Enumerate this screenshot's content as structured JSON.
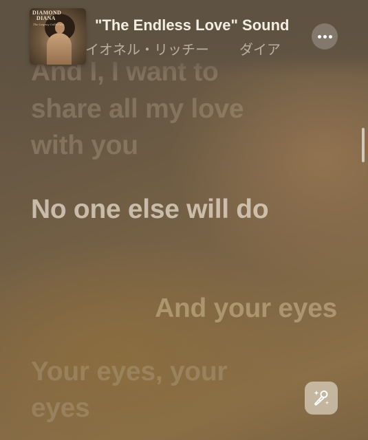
{
  "now_playing": {
    "title": "\"The Endless Love\" Sound",
    "artists": [
      "イオネル・リッチー",
      "ダイア"
    ],
    "artwork": {
      "title_line1": "DIAMOND",
      "title_line2": "DIANA",
      "subtitle": "The Legacy Collection"
    }
  },
  "lyrics": [
    {
      "text": "And I, I want to",
      "state": "past"
    },
    {
      "text": "share all my love with you",
      "state": "past"
    },
    {
      "text": "No one else will do",
      "state": "current"
    },
    {
      "text": "And your eyes",
      "state": "background-vocal"
    },
    {
      "text": "Your eyes, your eyes",
      "state": "upcoming"
    }
  ],
  "controls": {
    "more_icon": "ellipsis-icon",
    "sing_icon": "microphone-sparkles-icon"
  },
  "colors": {
    "background": "#7a6447",
    "title_text": "#f4ede2",
    "active_lyric": "#ebe1d2",
    "dim_lyric": "#bfaf96"
  }
}
